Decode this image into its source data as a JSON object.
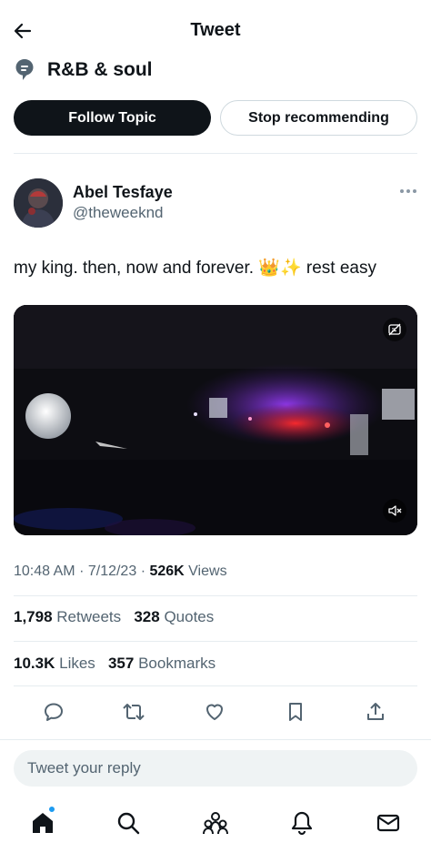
{
  "header": {
    "title": "Tweet"
  },
  "topic": {
    "name": "R&B & soul",
    "follow_label": "Follow Topic",
    "stop_label": "Stop recommending"
  },
  "tweet": {
    "author_name": "Abel Tesfaye",
    "author_handle": "@theweeknd",
    "text": "my king. then, now and forever. 👑✨ rest easy",
    "time": "10:48 AM",
    "date": "7/12/23",
    "views_count": "526K",
    "views_label": "Views",
    "retweets_count": "1,798",
    "retweets_label": "Retweets",
    "quotes_count": "328",
    "quotes_label": "Quotes",
    "likes_count": "10.3K",
    "likes_label": "Likes",
    "bookmarks_count": "357",
    "bookmarks_label": "Bookmarks"
  },
  "reply": {
    "placeholder": "Tweet your reply"
  },
  "icons": {
    "back": "arrow-left-icon",
    "topic": "topic-bubble-icon",
    "more": "ellipsis-icon",
    "captions": "captions-off-icon",
    "mute": "volume-muted-icon",
    "reply": "reply-icon",
    "retweet": "retweet-icon",
    "like": "heart-icon",
    "bookmark": "bookmark-icon",
    "share": "share-icon",
    "home": "home-icon",
    "search": "search-icon",
    "communities": "communities-icon",
    "notifications": "bell-icon",
    "messages": "mail-icon"
  },
  "colors": {
    "accent": "#1d9bf0",
    "text": "#0f1419",
    "secondary": "#536471"
  }
}
